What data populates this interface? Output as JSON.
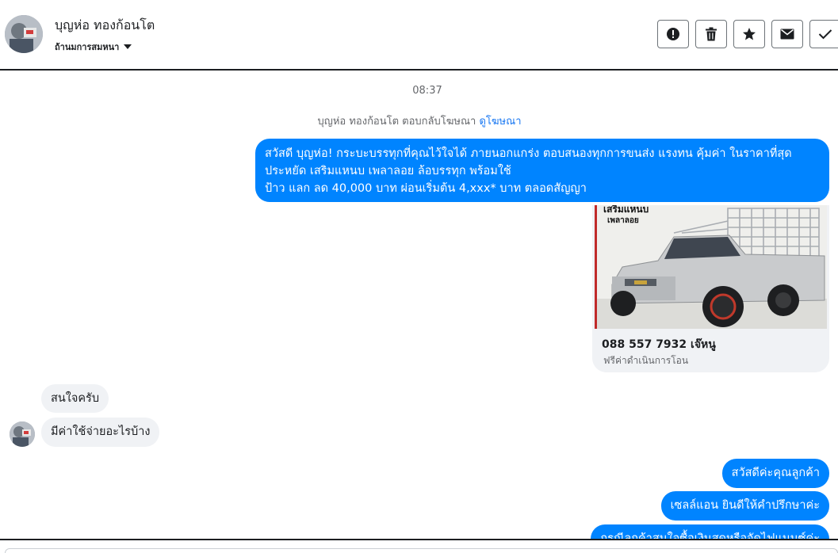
{
  "header": {
    "contact_name": "บุญห่อ ทองก้อนโต",
    "assign_label": "ถ้านมการสมหนา",
    "actions": [
      {
        "name": "report-button",
        "icon": "exclamation-circle-icon"
      },
      {
        "name": "delete-button",
        "icon": "trash-icon"
      },
      {
        "name": "star-button",
        "icon": "star-icon"
      },
      {
        "name": "mark-unread-button",
        "icon": "envelope-icon"
      },
      {
        "name": "mark-done-button",
        "icon": "check-icon"
      }
    ]
  },
  "conversation": {
    "timestamp": "08:37",
    "reply_notice": "บุญห่อ ทองก้อนโต ตอบกลับโฆษณา",
    "view_ad_link": "ดูโฆษณา",
    "ad_message": {
      "line1": "สวัสดี บุญห่อ! กระบะบรรทุกที่คุณไว้ใจได้ ภายนอกแกร่ง ตอบสนองทุกการขนส่ง แรงทน คุ้มค่า ในราคาที่สุด",
      "line2": "ประหยัด เสริมแหนบ เพลาลอย ล้อบรรทุก พร้อมใช้",
      "line3": "ป้าว แลก ลด 40,000 บาท ผ่อนเริ่มต้น 4,xxx* บาท ตลอดสัญญา"
    },
    "ad_card": {
      "image_text_1": "เสริมแหนบ",
      "image_text_2": "เพลาลอย",
      "title": "088 557 7932 เจ๊หนู",
      "subtitle": "ฟรีค่าดำเนินการโอน"
    },
    "incoming": [
      "สนใจครับ",
      "มีค่าใช้จ่ายอะไรบ้าง"
    ],
    "outgoing": [
      "สวัสดีค่ะคุณลูกค้า",
      "เซลล์แอน ยินดีให้คำปรึกษาค่ะ",
      "กรณีลูกค้าสนใจซื้อเงินสดหรือจัดไฟแนนซ์ค่ะ"
    ]
  },
  "colors": {
    "outgoing_bubble": "#0084ff",
    "incoming_bubble": "#f0f2f5",
    "link": "#1877f2"
  }
}
